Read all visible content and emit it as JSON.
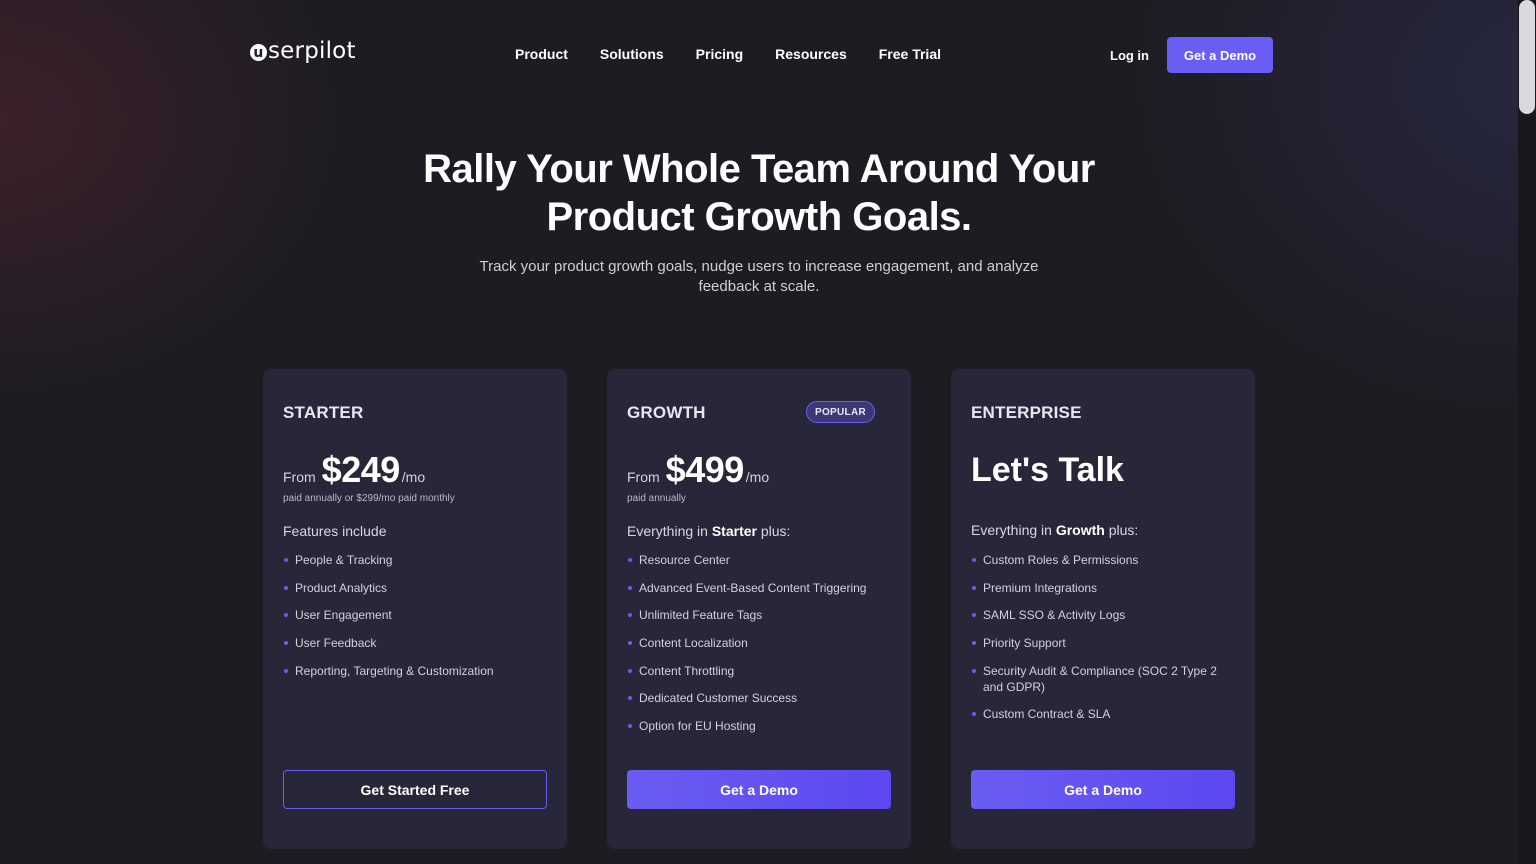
{
  "nav": {
    "logo_mark": "u",
    "logo_text": "serpilot",
    "links": [
      "Product",
      "Solutions",
      "Pricing",
      "Resources",
      "Free Trial"
    ],
    "login": "Log in",
    "demo": "Get a Demo"
  },
  "hero": {
    "title_line1": "Rally Your Whole Team Around Your",
    "title_line2": "Product Growth Goals.",
    "subtitle_line1": "Track your product growth goals, nudge users to increase engagement, and analyze",
    "subtitle_line2": "feedback at scale."
  },
  "plans": {
    "starter": {
      "name": "STARTER",
      "from": "From",
      "price": "$249",
      "unit": "/mo",
      "note": "paid annually or $299/mo paid monthly",
      "features_title": "Features include",
      "features": [
        "People & Tracking",
        "Product Analytics",
        "User Engagement",
        "User Feedback",
        "Reporting, Targeting & Customization"
      ],
      "cta": "Get Started Free"
    },
    "growth": {
      "name": "GROWTH",
      "badge": "POPULAR",
      "from": "From",
      "price": "$499",
      "unit": "/mo",
      "note": "paid annually",
      "features_prefix": "Everything in ",
      "features_ref": "Starter",
      "features_suffix": " plus:",
      "features": [
        "Resource Center",
        "Advanced Event-Based Content Triggering",
        "Unlimited Feature Tags",
        "Content Localization",
        "Content Throttling",
        "Dedicated Customer Success",
        "Option for EU Hosting"
      ],
      "cta": "Get a Demo"
    },
    "enterprise": {
      "name": "ENTERPRISE",
      "headline": "Let's Talk",
      "features_prefix": "Everything in ",
      "features_ref": "Growth",
      "features_suffix": " plus:",
      "features": [
        "Custom Roles & Permissions",
        "Premium Integrations",
        "SAML SSO & Activity Logs",
        "Priority Support",
        "Security Audit & Compliance (SOC 2 Type 2 and GDPR)",
        "Custom Contract & SLA"
      ],
      "cta": "Get a Demo"
    }
  },
  "colors": {
    "accent": "#6a5df3",
    "card": "#272739",
    "background": "#1c1c22"
  }
}
